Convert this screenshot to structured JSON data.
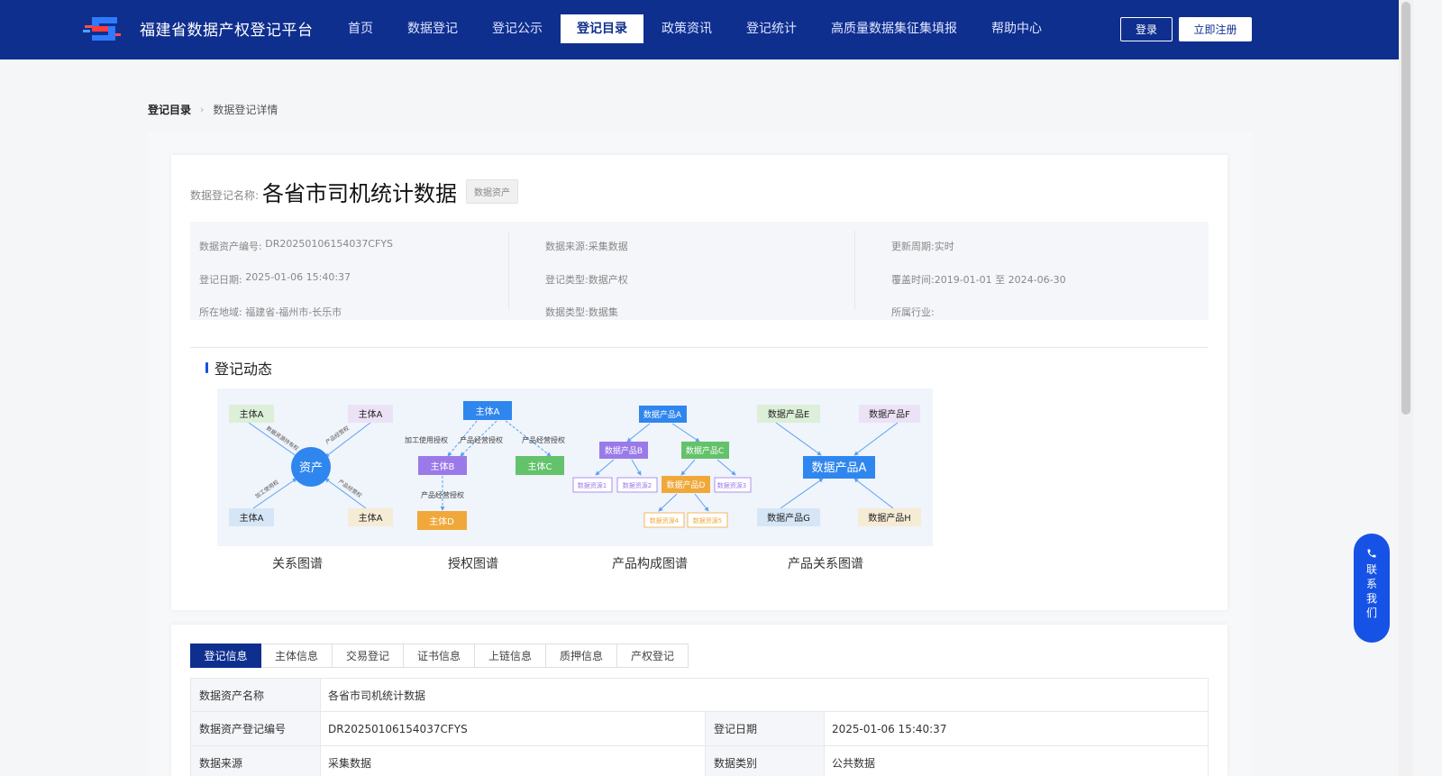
{
  "header": {
    "brand": "福建省数据产权登记平台",
    "nav": [
      "首页",
      "数据登记",
      "登记公示",
      "登记目录",
      "政策资讯",
      "登记统计",
      "高质量数据集征集填报",
      "帮助中心"
    ],
    "active_nav": "登记目录",
    "login": "登录",
    "register": "立即注册"
  },
  "breadcrumb": {
    "first": "登记目录",
    "second": "数据登记详情"
  },
  "record": {
    "name_label": "数据登记名称:",
    "name": "各省市司机统计数据",
    "tag": "数据资产"
  },
  "info": {
    "asset_no_key": "数据资产编号:",
    "asset_no": "DR20250106154037CFYS",
    "reg_date_key": "登记日期:",
    "reg_date": "2025-01-06 15:40:37",
    "region_key": "所在地域:",
    "region": "福建省-福州市-长乐市",
    "source_key": "数据来源:",
    "source": "采集数据",
    "reg_type_key": "登记类型:",
    "reg_type": "数据产权",
    "data_type_key": "数据类型:",
    "data_type": "数据集",
    "cycle_key": "更新周期:",
    "cycle": "实时",
    "cover_key": "覆盖时间:",
    "cover": "2019-01-01 至 2024-06-30",
    "industry_key": "所属行业:",
    "industry": ""
  },
  "section": {
    "title": "登记动态"
  },
  "graphs": {
    "labels": [
      "关系图谱",
      "授权图谱",
      "产品构成图谱",
      "产品关系图谱"
    ],
    "g1": {
      "center": "资产",
      "nodes": [
        "主体A",
        "主体A",
        "主体A",
        "主体A"
      ],
      "edges": [
        "数据资源持有权",
        "产品经营权",
        "加工使用权",
        "产品经营权"
      ]
    },
    "g2": {
      "top": "主体A",
      "left": "主体B",
      "right": "主体C",
      "bottom": "主体D",
      "edges": [
        "加工使用授权",
        "产品经营授权",
        "产品经营授权",
        "产品经营授权"
      ]
    },
    "g3": {
      "top": "数据产品A",
      "b": "数据产品B",
      "c": "数据产品C",
      "d": "数据产品D",
      "resources": [
        "数据资源1",
        "数据资源2",
        "数据资源3",
        "数据资源4",
        "数据资源5"
      ]
    },
    "g4": {
      "center": "数据产品A",
      "nodes": [
        "数据产品E",
        "数据产品F",
        "数据产品G",
        "数据产品H"
      ]
    }
  },
  "contact": {
    "chars": [
      "联",
      "系",
      "我",
      "们"
    ]
  },
  "tabs": [
    "登记信息",
    "主体信息",
    "交易登记",
    "证书信息",
    "上链信息",
    "质押信息",
    "产权登记"
  ],
  "active_tab": "登记信息",
  "table": {
    "row1": {
      "k1": "数据资产名称",
      "v1": "各省市司机统计数据"
    },
    "row2": {
      "k1": "数据资产登记编号",
      "v1": "DR20250106154037CFYS",
      "k2": "登记日期",
      "v2": "2025-01-06 15:40:37"
    },
    "row3": {
      "k1": "数据来源",
      "v1": "采集数据",
      "k2": "数据类别",
      "v2": "公共数据"
    }
  },
  "colors": {
    "primary": "#0f2f8f",
    "accent": "#1a4fe0"
  }
}
